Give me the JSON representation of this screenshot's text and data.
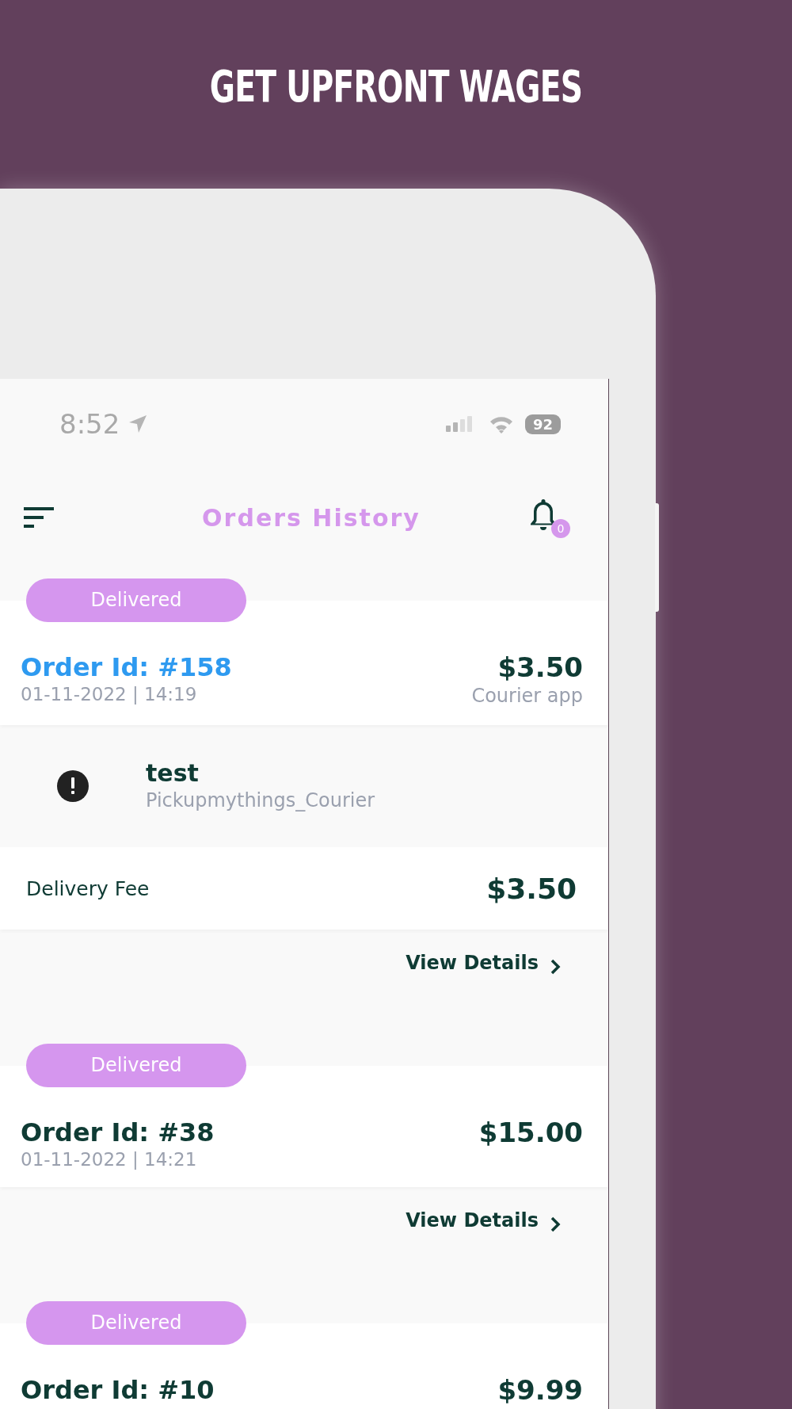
{
  "headline": "GET UPFRONT WAGES",
  "status_bar": {
    "time": "8:52",
    "battery": "92"
  },
  "header": {
    "title": "Orders History",
    "notification_count": "0"
  },
  "orders": [
    {
      "status": "Delivered",
      "order_id": "Order Id: #158",
      "highlighted": true,
      "date": "01-11-2022 | 14:19",
      "amount": "$3.50",
      "source": "Courier app",
      "merchant": {
        "name": "test",
        "subtitle": "Pickupmythings_Courier"
      },
      "fee": {
        "label": "Delivery Fee",
        "amount": "$3.50"
      },
      "link": "View Details"
    },
    {
      "status": "Delivered",
      "order_id": "Order Id: #38",
      "highlighted": false,
      "date": "01-11-2022 | 14:21",
      "amount": "$15.00",
      "link": "View Details"
    },
    {
      "status": "Delivered",
      "order_id": "Order Id: #10",
      "highlighted": false,
      "amount": "$9.99"
    }
  ]
}
